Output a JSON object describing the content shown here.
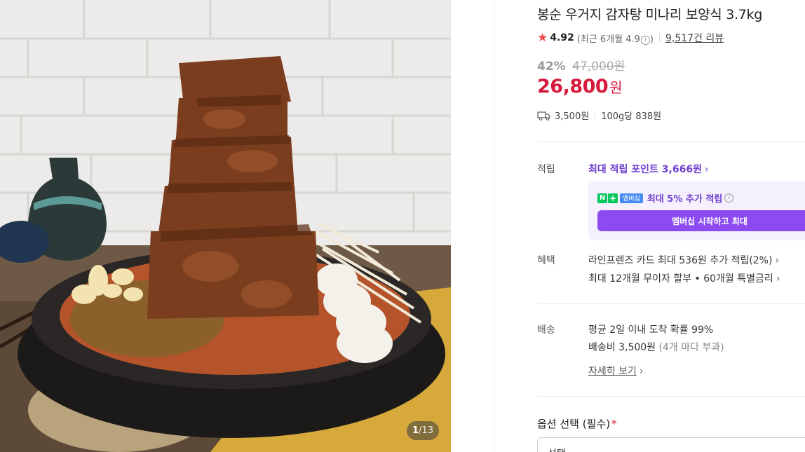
{
  "gallery": {
    "current": "1",
    "separator": "/",
    "total": "13"
  },
  "product": {
    "title": "봉순 우거지 감자탕 미나리 보양식 3.7kg",
    "rating": {
      "score": "4.92",
      "recent_label": "(최근 6개월 4.9",
      "recent_close": ")",
      "review_count": "9,517건 리뷰"
    },
    "discount_pct": "42%",
    "original_price": "47,000원",
    "price": "26,800",
    "price_unit": "원",
    "shipping_fee": "3,500원",
    "unit_price": "100g당 838원"
  },
  "points": {
    "label": "적립",
    "max_points": "최대 적립 포인트 3,666원",
    "membership_badge": "멤버십",
    "extra": "최대 5% 추가 적립",
    "button": "멤버십 시작하고 최대"
  },
  "benefits": {
    "label": "혜택",
    "card": "라인프렌즈 카드 최대 536원 추가 적립(2%)",
    "installment": "최대 12개월 무이자 할부 • 60개월 특별금리"
  },
  "delivery": {
    "label": "배송",
    "arrival": "평균 2일 이내 도착 확률 99%",
    "fee": "배송비 3,500원",
    "fee_note": "(4개 마다 부과)",
    "detail_link": "자세히 보기"
  },
  "options": {
    "title": "옵션 선택 (필수)",
    "required_mark": "*",
    "select_placeholder": "선택"
  },
  "colors": {
    "price_red": "#d61a3c",
    "points_purple": "#6e3fcf",
    "member_button": "#8b4bf0",
    "naver_green": "#03c75a"
  },
  "icons": [
    "star-icon",
    "info-icon",
    "truck-icon",
    "chevron-right-icon",
    "naver-plus-icon"
  ]
}
